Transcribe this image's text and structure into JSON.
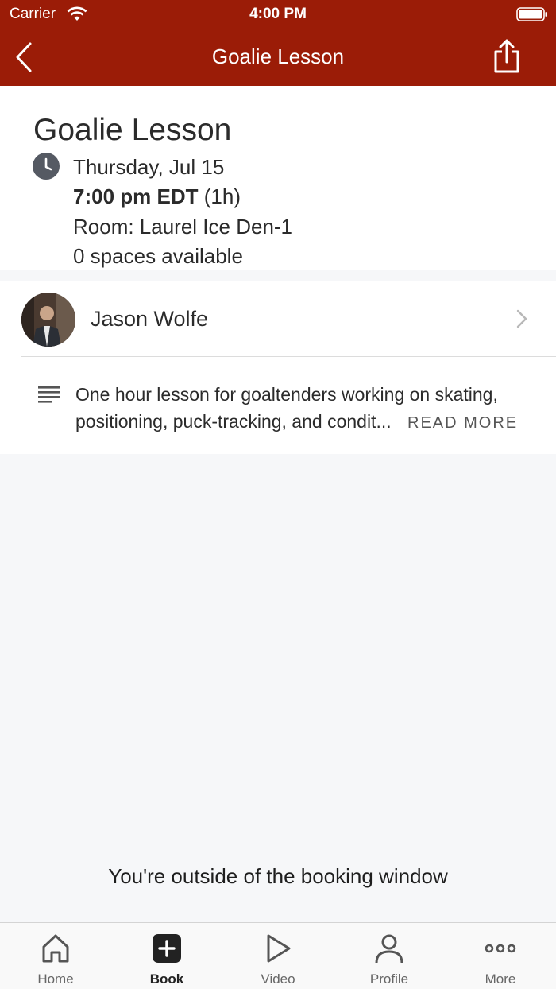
{
  "status": {
    "carrier": "Carrier",
    "time": "4:00 PM"
  },
  "nav": {
    "title": "Goalie Lesson"
  },
  "event": {
    "title": "Goalie Lesson",
    "date": "Thursday, Jul 15",
    "time": "7:00 pm EDT",
    "duration": "(1h)",
    "room": "Room: Laurel Ice Den-1",
    "spaces": "0 spaces available"
  },
  "instructor": {
    "name": "Jason Wolfe"
  },
  "description": {
    "text": "One hour lesson for goaltenders working on skating, positioning, puck-tracking, and condit...",
    "read_more": "READ MORE"
  },
  "booking": {
    "message": "You're outside of the booking window"
  },
  "tabs": [
    {
      "label": "Home",
      "icon": "home-icon"
    },
    {
      "label": "Book",
      "icon": "plus-square-icon"
    },
    {
      "label": "Video",
      "icon": "play-icon"
    },
    {
      "label": "Profile",
      "icon": "person-icon"
    },
    {
      "label": "More",
      "icon": "more-icon"
    }
  ],
  "colors": {
    "brand": "#9b1c07",
    "background": "#f6f7f9"
  }
}
